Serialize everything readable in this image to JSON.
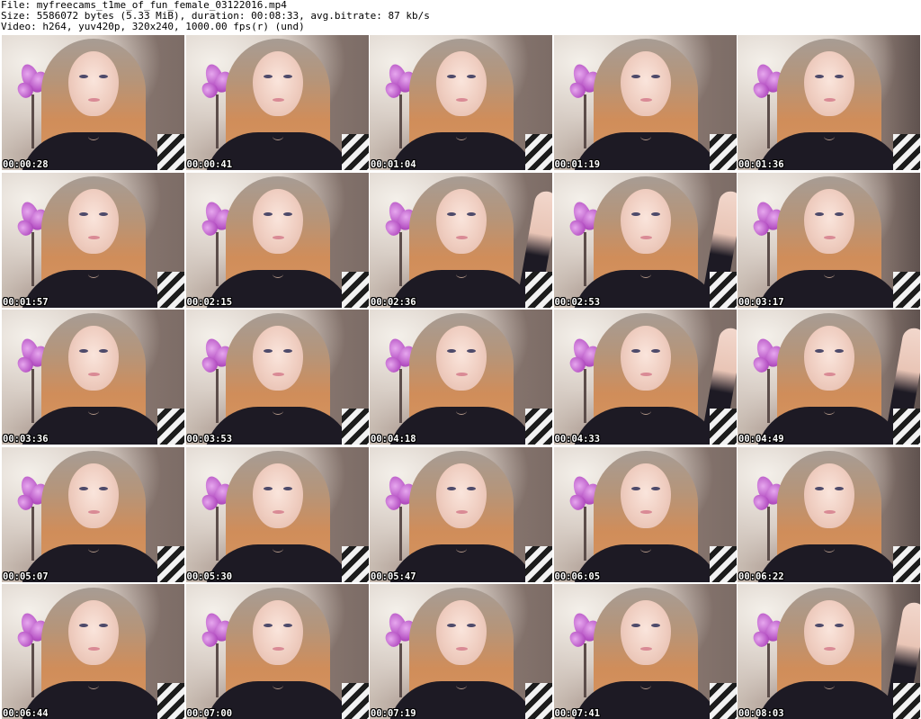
{
  "header": {
    "file_line": "File: myfreecams_t1me_of_fun_female_03122016.mp4",
    "size_line": "Size: 5586072 bytes (5.33 MiB), duration: 00:08:33, avg.bitrate: 87 kb/s",
    "video_line": "Video: h264, yuv420p, 320x240, 1000.00 fps(r) (und)"
  },
  "thumbnails": [
    {
      "timestamp": "00:00:28",
      "arm_raised": false
    },
    {
      "timestamp": "00:00:41",
      "arm_raised": false
    },
    {
      "timestamp": "00:01:04",
      "arm_raised": false
    },
    {
      "timestamp": "00:01:19",
      "arm_raised": false
    },
    {
      "timestamp": "00:01:36",
      "arm_raised": false
    },
    {
      "timestamp": "00:01:57",
      "arm_raised": false
    },
    {
      "timestamp": "00:02:15",
      "arm_raised": false
    },
    {
      "timestamp": "00:02:36",
      "arm_raised": true
    },
    {
      "timestamp": "00:02:53",
      "arm_raised": true
    },
    {
      "timestamp": "00:03:17",
      "arm_raised": false
    },
    {
      "timestamp": "00:03:36",
      "arm_raised": false
    },
    {
      "timestamp": "00:03:53",
      "arm_raised": false
    },
    {
      "timestamp": "00:04:18",
      "arm_raised": false
    },
    {
      "timestamp": "00:04:33",
      "arm_raised": true
    },
    {
      "timestamp": "00:04:49",
      "arm_raised": true
    },
    {
      "timestamp": "00:05:07",
      "arm_raised": false
    },
    {
      "timestamp": "00:05:30",
      "arm_raised": false
    },
    {
      "timestamp": "00:05:47",
      "arm_raised": false
    },
    {
      "timestamp": "00:06:05",
      "arm_raised": false
    },
    {
      "timestamp": "00:06:22",
      "arm_raised": false
    },
    {
      "timestamp": "00:06:44",
      "arm_raised": false
    },
    {
      "timestamp": "00:07:00",
      "arm_raised": false
    },
    {
      "timestamp": "00:07:19",
      "arm_raised": false
    },
    {
      "timestamp": "00:07:41",
      "arm_raised": false
    },
    {
      "timestamp": "00:08:03",
      "arm_raised": true
    }
  ],
  "colors": {
    "header_text": "#000000",
    "timestamp_text": "#ffffff",
    "timestamp_outline": "#000000",
    "background": "#ffffff"
  }
}
